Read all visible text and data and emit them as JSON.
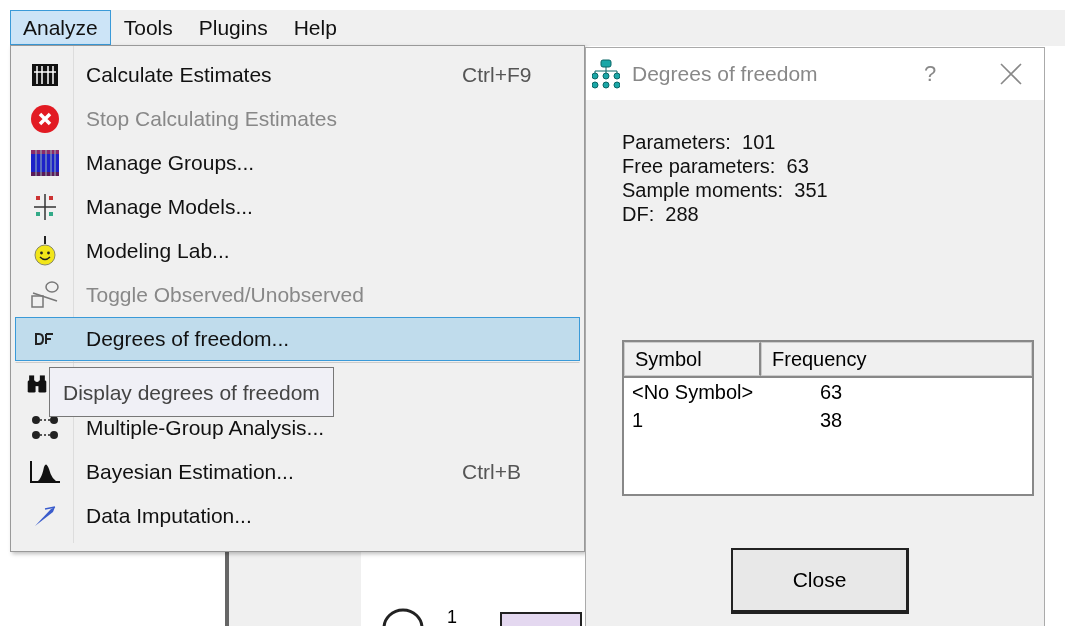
{
  "menubar": [
    {
      "label": "Analyze",
      "selected": true
    },
    {
      "label": "Tools",
      "selected": false
    },
    {
      "label": "Plugins",
      "selected": false
    },
    {
      "label": "Help",
      "selected": false
    }
  ],
  "menu": {
    "items": [
      {
        "label": "Calculate Estimates",
        "shortcut": "Ctrl+F9",
        "disabled": false,
        "selected": false,
        "separator_before": false
      },
      {
        "label": "Stop Calculating Estimates",
        "disabled": true,
        "selected": false,
        "separator_before": false
      },
      {
        "label": "Manage Groups...",
        "disabled": false,
        "selected": false,
        "separator_before": false
      },
      {
        "label": "Manage Models...",
        "disabled": false,
        "selected": false,
        "separator_before": false
      },
      {
        "label": "Modeling Lab...",
        "disabled": false,
        "selected": false,
        "separator_before": false
      },
      {
        "label": "Toggle Observed/Unobserved",
        "disabled": true,
        "selected": false,
        "separator_before": false
      },
      {
        "label": "Degrees of freedom...",
        "disabled": false,
        "selected": true,
        "separator_before": false
      },
      {
        "disabled": false,
        "selected": false,
        "separator_before": true
      },
      {
        "label": "Multiple-Group Analysis...",
        "disabled": false,
        "selected": false,
        "separator_before": false
      },
      {
        "label": "Bayesian Estimation...",
        "shortcut": "Ctrl+B",
        "disabled": false,
        "selected": false,
        "separator_before": false
      },
      {
        "label": "Data Imputation...",
        "disabled": false,
        "selected": false,
        "separator_before": false
      }
    ]
  },
  "tooltip": "Display degrees of freedom",
  "dialog": {
    "title": "Degrees of freedom",
    "help": "?",
    "stats": [
      "Parameters:  101",
      "Free parameters:  63",
      "Sample moments:  351",
      "DF:  288"
    ],
    "table": {
      "columns": [
        "Symbol",
        "Frequency"
      ],
      "rows": [
        [
          "<No Symbol>",
          "63"
        ],
        [
          "1",
          "38"
        ]
      ]
    },
    "button": "Close"
  },
  "canvas": {
    "label": "1"
  }
}
